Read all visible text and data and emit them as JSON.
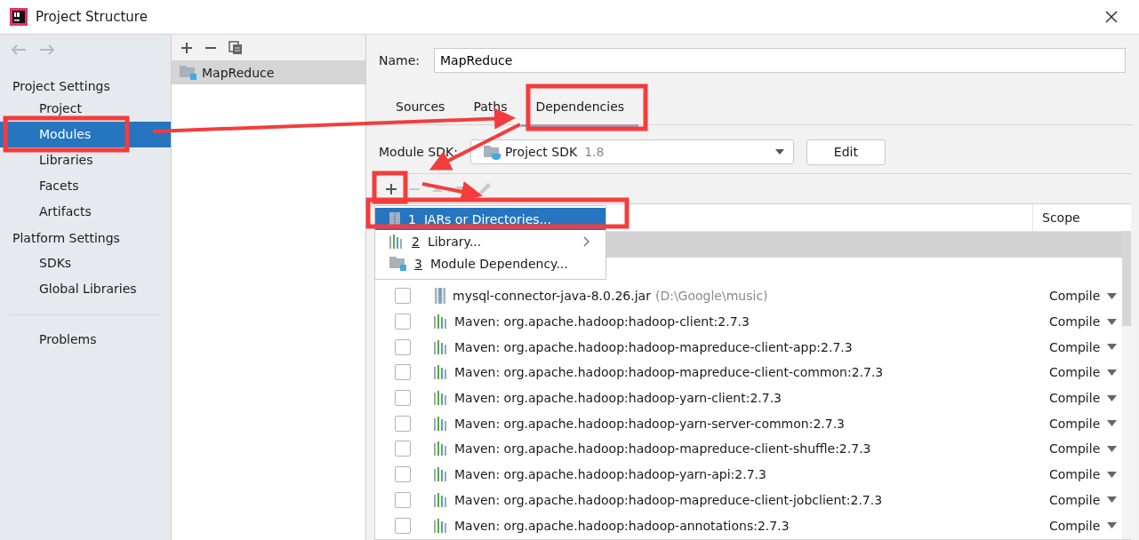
{
  "window": {
    "title": "Project Structure"
  },
  "sidebar": {
    "sections": [
      {
        "title": "Project Settings",
        "items": [
          {
            "label": "Project",
            "selected": false
          },
          {
            "label": "Modules",
            "selected": true
          },
          {
            "label": "Libraries",
            "selected": false
          },
          {
            "label": "Facets",
            "selected": false
          },
          {
            "label": "Artifacts",
            "selected": false
          }
        ]
      },
      {
        "title": "Platform Settings",
        "items": [
          {
            "label": "SDKs",
            "selected": false
          },
          {
            "label": "Global Libraries",
            "selected": false
          }
        ]
      }
    ],
    "extra_items": [
      {
        "label": "Problems",
        "selected": false
      }
    ]
  },
  "modules": {
    "items": [
      {
        "label": "MapReduce",
        "selected": true
      }
    ]
  },
  "name_field": {
    "label": "Name:",
    "value": "MapReduce"
  },
  "tabs": [
    {
      "label": "Sources",
      "selected": false
    },
    {
      "label": "Paths",
      "selected": false
    },
    {
      "label": "Dependencies",
      "selected": true
    }
  ],
  "sdk": {
    "label": "Module SDK:",
    "value": "Project SDK",
    "version": "1.8",
    "button": "Edit"
  },
  "popup": {
    "items": [
      {
        "number": "1",
        "label": "JARs or Directories...",
        "kind": "jar",
        "selected": true,
        "submenu": false
      },
      {
        "number": "2",
        "label": "Library...",
        "kind": "library",
        "selected": false,
        "submenu": true
      },
      {
        "number": "3",
        "label": "Module Dependency...",
        "kind": "module",
        "selected": false,
        "submenu": false
      }
    ]
  },
  "table": {
    "columns": [
      "Scope"
    ],
    "hidden_rows": [
      {
        "selected": true
      },
      {
        "selected": false
      }
    ],
    "rows": [
      {
        "kind": "jar",
        "name": "mysql-connector-java-8.0.26.jar",
        "path": "(D:\\Google\\music)",
        "checked": false,
        "scope": "Compile"
      },
      {
        "kind": "maven",
        "name": "Maven: org.apache.hadoop:hadoop-client:2.7.3",
        "checked": false,
        "scope": "Compile"
      },
      {
        "kind": "maven",
        "name": "Maven: org.apache.hadoop:hadoop-mapreduce-client-app:2.7.3",
        "checked": false,
        "scope": "Compile"
      },
      {
        "kind": "maven",
        "name": "Maven: org.apache.hadoop:hadoop-mapreduce-client-common:2.7.3",
        "checked": false,
        "scope": "Compile"
      },
      {
        "kind": "maven",
        "name": "Maven: org.apache.hadoop:hadoop-yarn-client:2.7.3",
        "checked": false,
        "scope": "Compile"
      },
      {
        "kind": "maven",
        "name": "Maven: org.apache.hadoop:hadoop-yarn-server-common:2.7.3",
        "checked": false,
        "scope": "Compile"
      },
      {
        "kind": "maven",
        "name": "Maven: org.apache.hadoop:hadoop-mapreduce-client-shuffle:2.7.3",
        "checked": false,
        "scope": "Compile"
      },
      {
        "kind": "maven",
        "name": "Maven: org.apache.hadoop:hadoop-yarn-api:2.7.3",
        "checked": false,
        "scope": "Compile"
      },
      {
        "kind": "maven",
        "name": "Maven: org.apache.hadoop:hadoop-mapreduce-client-jobclient:2.7.3",
        "checked": false,
        "scope": "Compile"
      },
      {
        "kind": "maven",
        "name": "Maven: org.apache.hadoop:hadoop-annotations:2.7.3",
        "checked": false,
        "scope": "Compile"
      }
    ]
  }
}
